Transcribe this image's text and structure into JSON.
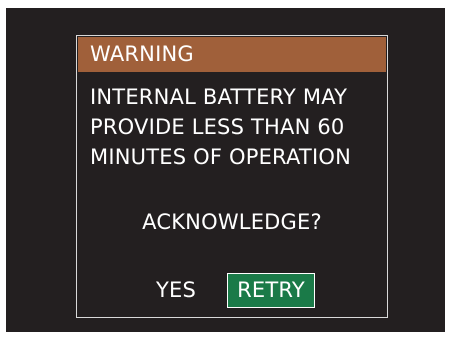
{
  "dialog": {
    "title": "WARNING",
    "message_lines": [
      "INTERNAL BATTERY MAY",
      "PROVIDE LESS THAN 60",
      "MINUTES OF OPERATION"
    ],
    "question": "ACKNOWLEDGE?",
    "buttons": {
      "yes_label": "YES",
      "retry_label": "RETRY",
      "selected": "RETRY"
    }
  },
  "colors": {
    "screen_background": "#231f20",
    "title_bar": "#a0603a",
    "selected_button": "#1a7a48",
    "text": "#ffffff"
  }
}
